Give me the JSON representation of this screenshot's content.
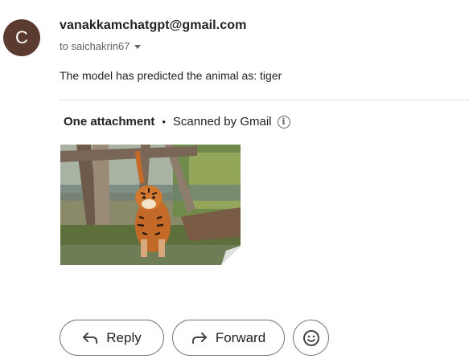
{
  "email": {
    "avatar_letter": "C",
    "sender": "vanakkamchatgpt@gmail.com",
    "recipient": "to saichakrin67",
    "body": "The model has predicted the animal as: tiger"
  },
  "attachments": {
    "count_label": "One attachment",
    "separator": "•",
    "scan_label": "Scanned by Gmail",
    "items": [
      {
        "kind": "image",
        "subject": "tiger"
      }
    ]
  },
  "actions": {
    "reply_label": "Reply",
    "forward_label": "Forward"
  },
  "colors": {
    "avatar_bg": "#5b3b30",
    "text": "#202124",
    "muted": "#5f6368",
    "border": "#747775"
  },
  "icons": [
    "info-icon",
    "chevron-down-icon",
    "reply-icon",
    "forward-icon",
    "emoji-icon"
  ]
}
